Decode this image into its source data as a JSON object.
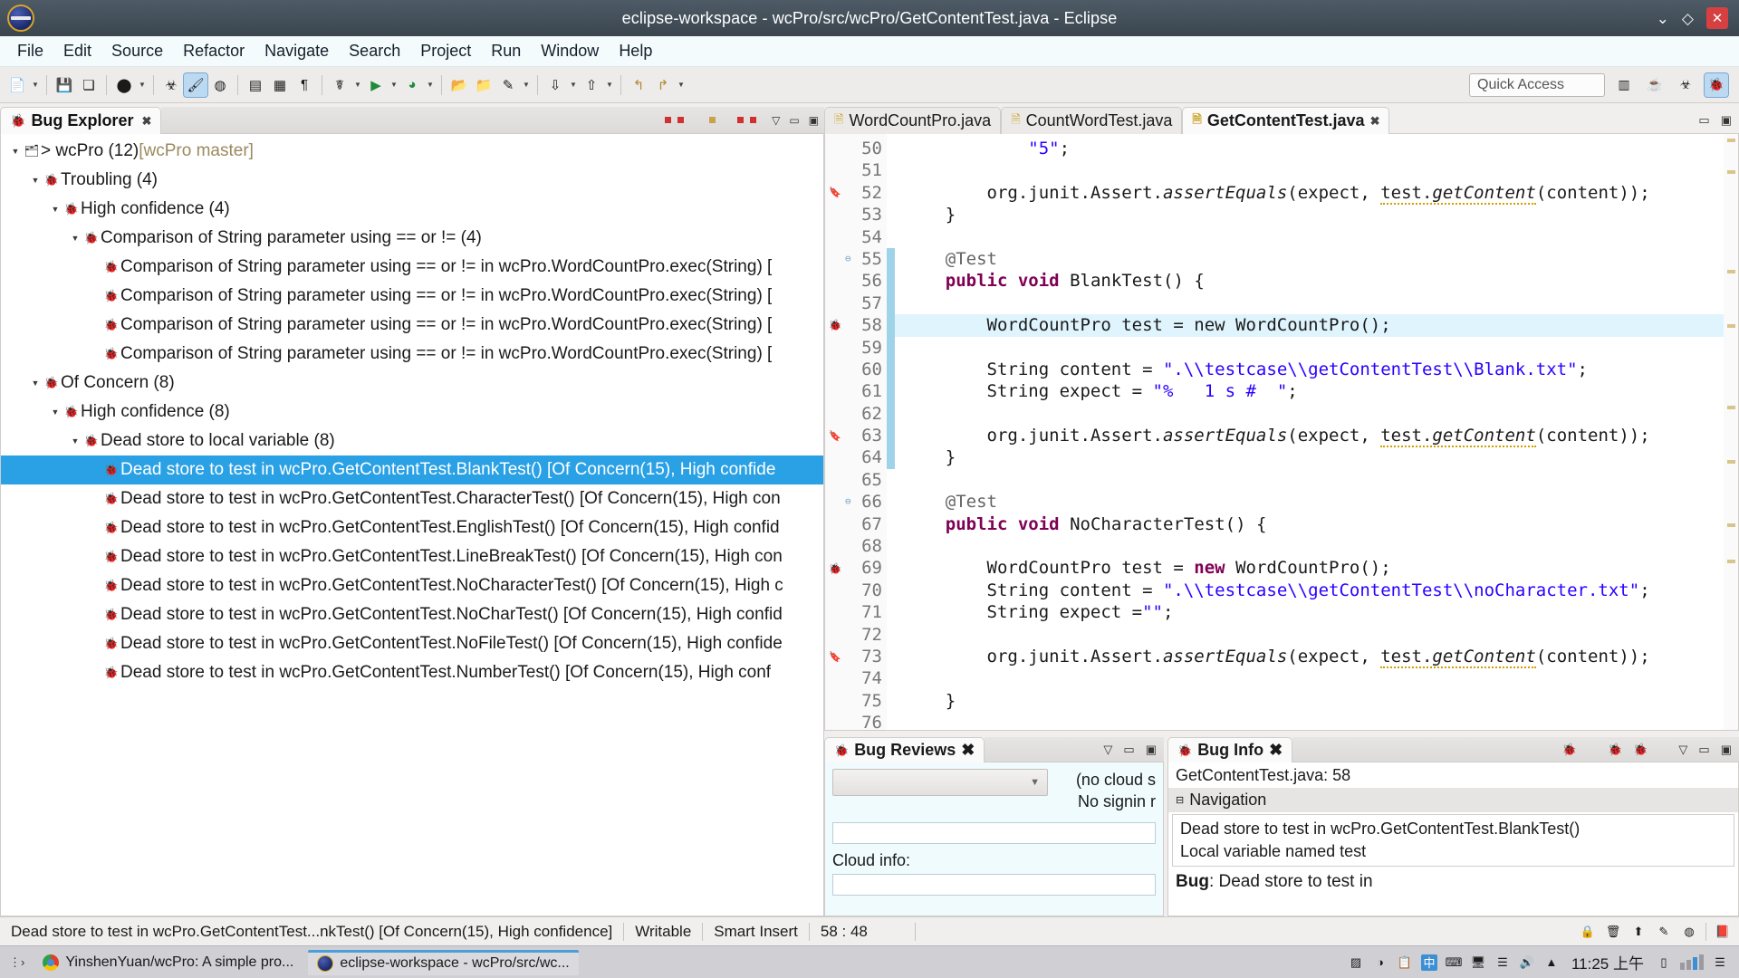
{
  "window": {
    "title": "eclipse-workspace - wcPro/src/wcPro/GetContentTest.java - Eclipse",
    "minimize": "⌄",
    "maximize": "◇",
    "close": "✕"
  },
  "menubar": [
    "File",
    "Edit",
    "Source",
    "Refactor",
    "Navigate",
    "Search",
    "Project",
    "Run",
    "Window",
    "Help"
  ],
  "toolbar": {
    "quick_access_placeholder": "Quick Access",
    "items": [
      {
        "name": "new-wizard-icon",
        "glyph": "Ὄ4"
      },
      {
        "name": "save-icon",
        "glyph": "ὋE"
      },
      {
        "name": "save-all-icon",
        "glyph": "⧉"
      },
      {
        "name": "debug-icon",
        "glyph": "⚫"
      },
      {
        "name": "find-bugs-icon",
        "glyph": "☢"
      },
      {
        "name": "highlight-icon",
        "glyph": "✎"
      },
      {
        "name": "clear-icon",
        "glyph": "●"
      },
      {
        "name": "new-java-package-icon",
        "glyph": "▤"
      },
      {
        "name": "new-class-icon",
        "glyph": "▧"
      },
      {
        "name": "new-annotation-icon",
        "glyph": "¶"
      },
      {
        "name": "debug-run-icon",
        "glyph": "☣"
      },
      {
        "name": "run-icon",
        "glyph": "▶"
      },
      {
        "name": "coverage-icon",
        "glyph": "⚿"
      },
      {
        "name": "open-type-icon",
        "glyph": "Ὄ2"
      },
      {
        "name": "open-resource-icon",
        "glyph": "Ὄ1"
      },
      {
        "name": "pencil-icon",
        "glyph": "✐"
      },
      {
        "name": "next-annotation-icon",
        "glyph": "↓"
      },
      {
        "name": "previous-annotation-icon",
        "glyph": "↑"
      },
      {
        "name": "back-icon",
        "glyph": "↶"
      },
      {
        "name": "forward-icon",
        "glyph": "↷"
      }
    ]
  },
  "bug_explorer": {
    "tab_label": "Bug Explorer",
    "tree": [
      {
        "depth": 0,
        "arrow": "▼",
        "icon": "὜0",
        "label": "> wcPro (12) ",
        "meta": "[wcPro master]",
        "selected": false
      },
      {
        "depth": 1,
        "arrow": "▼",
        "icon": "☢",
        "label": "Troubling (4)",
        "meta": "",
        "selected": false
      },
      {
        "depth": 2,
        "arrow": "▼",
        "icon": "☣",
        "label": "High confidence (4)",
        "meta": "",
        "selected": false
      },
      {
        "depth": 3,
        "arrow": "▼",
        "icon": "☢",
        "label": "Comparison of String parameter using == or != (4)",
        "meta": "",
        "selected": false
      },
      {
        "depth": 4,
        "arrow": "",
        "icon": "☢",
        "label": "Comparison of String parameter using == or != in wcPro.WordCountPro.exec(String) [",
        "meta": "",
        "selected": false
      },
      {
        "depth": 4,
        "arrow": "",
        "icon": "☢",
        "label": "Comparison of String parameter using == or != in wcPro.WordCountPro.exec(String) [",
        "meta": "",
        "selected": false
      },
      {
        "depth": 4,
        "arrow": "",
        "icon": "☢",
        "label": "Comparison of String parameter using == or != in wcPro.WordCountPro.exec(String) [",
        "meta": "",
        "selected": false
      },
      {
        "depth": 4,
        "arrow": "",
        "icon": "☢",
        "label": "Comparison of String parameter using == or != in wcPro.WordCountPro.exec(String) [",
        "meta": "",
        "selected": false
      },
      {
        "depth": 1,
        "arrow": "▼",
        "icon": "☢",
        "label": "Of Concern (8)",
        "meta": "",
        "selected": false
      },
      {
        "depth": 2,
        "arrow": "▼",
        "icon": "☣",
        "label": "High confidence (8)",
        "meta": "",
        "selected": false
      },
      {
        "depth": 3,
        "arrow": "▼",
        "icon": "☢",
        "label": "Dead store to local variable (8)",
        "meta": "",
        "selected": false
      },
      {
        "depth": 4,
        "arrow": "",
        "icon": "☢",
        "label": "Dead store to test in wcPro.GetContentTest.BlankTest() [Of Concern(15), High confide",
        "meta": "",
        "selected": true
      },
      {
        "depth": 4,
        "arrow": "",
        "icon": "☢",
        "label": "Dead store to test in wcPro.GetContentTest.CharacterTest() [Of Concern(15), High con",
        "meta": "",
        "selected": false
      },
      {
        "depth": 4,
        "arrow": "",
        "icon": "☢",
        "label": "Dead store to test in wcPro.GetContentTest.EnglishTest() [Of Concern(15), High confid",
        "meta": "",
        "selected": false
      },
      {
        "depth": 4,
        "arrow": "",
        "icon": "☢",
        "label": "Dead store to test in wcPro.GetContentTest.LineBreakTest() [Of Concern(15), High con",
        "meta": "",
        "selected": false
      },
      {
        "depth": 4,
        "arrow": "",
        "icon": "☢",
        "label": "Dead store to test in wcPro.GetContentTest.NoCharacterTest() [Of Concern(15), High c",
        "meta": "",
        "selected": false
      },
      {
        "depth": 4,
        "arrow": "",
        "icon": "☢",
        "label": "Dead store to test in wcPro.GetContentTest.NoCharTest() [Of Concern(15), High confid",
        "meta": "",
        "selected": false
      },
      {
        "depth": 4,
        "arrow": "",
        "icon": "☢",
        "label": "Dead store to test in wcPro.GetContentTest.NoFileTest() [Of Concern(15), High confide",
        "meta": "",
        "selected": false
      },
      {
        "depth": 4,
        "arrow": "",
        "icon": "☢",
        "label": "Dead store to test in wcPro.GetContentTest.NumberTest() [Of Concern(15), High conf",
        "meta": "",
        "selected": false
      }
    ]
  },
  "editor": {
    "tabs": [
      {
        "label": "WordCountPro.java",
        "active": false,
        "closable": false
      },
      {
        "label": "CountWordTest.java",
        "active": false,
        "closable": false
      },
      {
        "label": "GetContentTest.java",
        "active": true,
        "closable": true
      }
    ],
    "first_line": 50,
    "lines": [
      {
        "n": 50,
        "marker": "",
        "change": false,
        "fold": "",
        "html": "            <span class=\"str\">\"5\"</span>;"
      },
      {
        "n": 51,
        "marker": "",
        "change": false,
        "fold": "",
        "html": ""
      },
      {
        "n": 52,
        "marker": "warn",
        "change": false,
        "fold": "",
        "html": "        org.junit.Assert.<span class=\"it\">assertEquals</span>(expect, <span class=\"und\">test.<span class=\"it\">getContent</span></span>(content));"
      },
      {
        "n": 53,
        "marker": "",
        "change": false,
        "fold": "",
        "html": "    }"
      },
      {
        "n": 54,
        "marker": "",
        "change": false,
        "fold": "",
        "html": ""
      },
      {
        "n": 55,
        "marker": "",
        "change": true,
        "fold": "⊖",
        "html": "    <span class=\"ann\">@Test</span>"
      },
      {
        "n": 56,
        "marker": "",
        "change": true,
        "fold": "",
        "html": "    <span class=\"kw\">public</span> <span class=\"kw\">void</span> BlankTest() {"
      },
      {
        "n": 57,
        "marker": "",
        "change": true,
        "fold": "",
        "html": ""
      },
      {
        "n": 58,
        "marker": "bug",
        "change": true,
        "fold": "",
        "html": "HIGHLIGHT"
      },
      {
        "n": 59,
        "marker": "",
        "change": true,
        "fold": "",
        "html": ""
      },
      {
        "n": 60,
        "marker": "",
        "change": true,
        "fold": "",
        "html": "        String content = <span class=\"str\">\".\\\\testcase\\\\getContentTest\\\\Blank.txt\"</span>;"
      },
      {
        "n": 61,
        "marker": "",
        "change": true,
        "fold": "",
        "html": "        String expect = <span class=\"str\">\"%   1 s #  \"</span>;"
      },
      {
        "n": 62,
        "marker": "",
        "change": true,
        "fold": "",
        "html": ""
      },
      {
        "n": 63,
        "marker": "warn",
        "change": true,
        "fold": "",
        "html": "        org.junit.Assert.<span class=\"it\">assertEquals</span>(expect, <span class=\"und\">test.<span class=\"it\">getContent</span></span>(content));"
      },
      {
        "n": 64,
        "marker": "",
        "change": true,
        "fold": "",
        "html": "    }"
      },
      {
        "n": 65,
        "marker": "",
        "change": false,
        "fold": "",
        "html": ""
      },
      {
        "n": 66,
        "marker": "",
        "change": false,
        "fold": "⊖",
        "html": "    <span class=\"ann\">@Test</span>"
      },
      {
        "n": 67,
        "marker": "",
        "change": false,
        "fold": "",
        "html": "    <span class=\"kw\">public</span> <span class=\"kw\">void</span> NoCharacterTest() {"
      },
      {
        "n": 68,
        "marker": "",
        "change": false,
        "fold": "",
        "html": ""
      },
      {
        "n": 69,
        "marker": "bug",
        "change": false,
        "fold": "",
        "html": "        WordCountPro test = <span class=\"kw\">new</span> WordCountPro();"
      },
      {
        "n": 70,
        "marker": "",
        "change": false,
        "fold": "",
        "html": "        String content = <span class=\"str\">\".\\\\testcase\\\\getContentTest\\\\noCharacter.txt\"</span>;"
      },
      {
        "n": 71,
        "marker": "",
        "change": false,
        "fold": "",
        "html": "        String expect =<span class=\"str\">\"\"</span>;"
      },
      {
        "n": 72,
        "marker": "",
        "change": false,
        "fold": "",
        "html": ""
      },
      {
        "n": 73,
        "marker": "warn",
        "change": false,
        "fold": "",
        "html": "        org.junit.Assert.<span class=\"it\">assertEquals</span>(expect, <span class=\"und\">test.<span class=\"it\">getContent</span></span>(content));"
      },
      {
        "n": 74,
        "marker": "",
        "change": false,
        "fold": "",
        "html": ""
      },
      {
        "n": 75,
        "marker": "",
        "change": false,
        "fold": "",
        "html": "    }"
      },
      {
        "n": 76,
        "marker": "",
        "change": false,
        "fold": "",
        "html": ""
      }
    ],
    "highlighted_line_text": "        WordCountPro test = new WordCountPro();"
  },
  "bug_reviews": {
    "tab_label": "Bug Reviews",
    "combo_value": "",
    "cloud_line1": "(no cloud s",
    "cloud_line2": "No signin r",
    "comment_value": "",
    "cloud_info_label": "Cloud info:",
    "cloud_info_value": ""
  },
  "bug_info": {
    "tab_label": "Bug Info",
    "file_line": "GetContentTest.java: 58",
    "navigation_label": "Navigation",
    "nav_items": [
      "Dead store to test in wcPro.GetContentTest.BlankTest()",
      "Local variable named test"
    ],
    "bug_label": "Bug",
    "bug_text": ": Dead store to test in"
  },
  "statusbar": {
    "message": "Dead store to test in wcPro.GetContentTest...nkTest() [Of Concern(15), High confidence]",
    "writable": "Writable",
    "insert_mode": "Smart Insert",
    "position": "58 : 48"
  },
  "taskbar": {
    "tasks": [
      {
        "label": "YinshenYuan/wcPro: A simple pro...",
        "icon": "chrome",
        "active": false
      },
      {
        "label": "eclipse-workspace - wcPro/src/wc...",
        "icon": "eclipse",
        "active": true
      }
    ],
    "clock": "11:25 上午"
  }
}
